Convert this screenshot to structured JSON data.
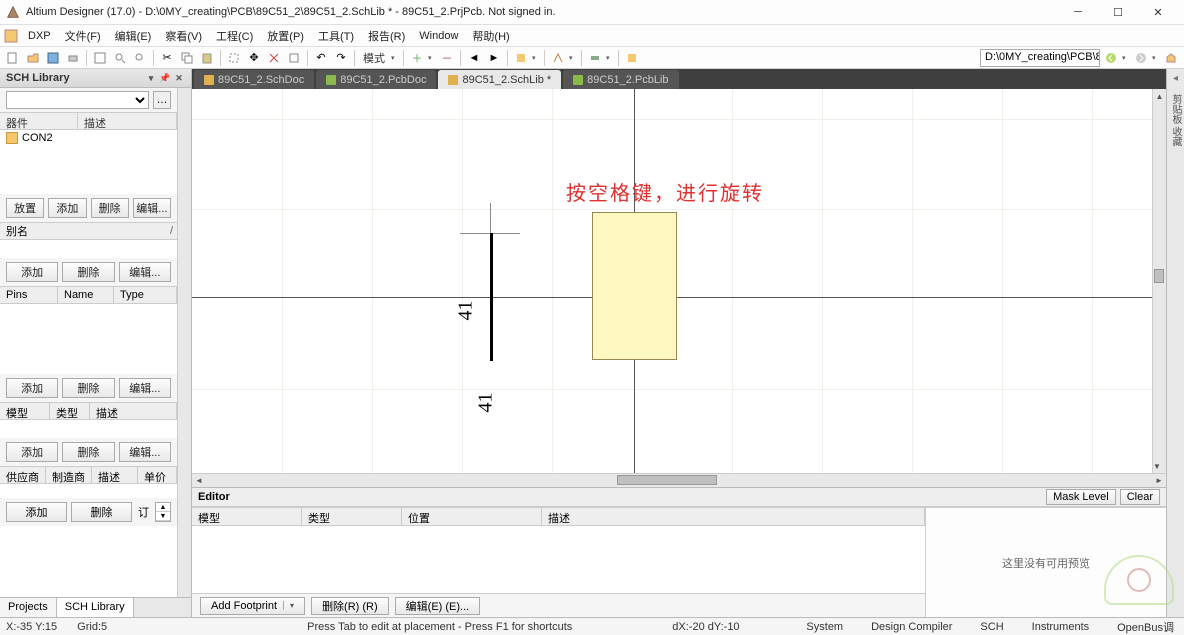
{
  "title": "Altium Designer (17.0) - D:\\0MY_creating\\PCB\\89C51_2\\89C51_2.SchLib * - 89C51_2.PrjPcb. Not signed in.",
  "menu": {
    "dxp": "DXP",
    "file": "文件(F)",
    "edit": "编辑(E)",
    "view": "察看(V)",
    "project": "工程(C)",
    "place": "放置(P)",
    "tools": "工具(T)",
    "report": "报告(R)",
    "window": "Window",
    "help": "帮助(H)"
  },
  "toolbar": {
    "mode": "模式",
    "path": "D:\\0MY_creating\\PCB\\89"
  },
  "panel": {
    "title": "SCH Library",
    "components": {
      "hdr_name": "器件",
      "hdr_desc": "描述",
      "items": [
        {
          "name": "CON2"
        }
      ]
    },
    "btns1": {
      "place": "放置",
      "add": "添加",
      "delete": "删除",
      "edit": "编辑..."
    },
    "alias": {
      "title": "别名",
      "add": "添加",
      "delete": "删除",
      "edit": "编辑..."
    },
    "pins": {
      "col1": "Pins",
      "col2": "Name",
      "col3": "Type",
      "add": "添加",
      "delete": "删除",
      "edit": "编辑..."
    },
    "model": {
      "col1": "模型",
      "col2": "类型",
      "col3": "描述",
      "add": "添加",
      "delete": "删除",
      "edit": "编辑..."
    },
    "supplier": {
      "col1": "供应商",
      "col2": "制造商",
      "col3": "描述",
      "col4": "单价",
      "add": "添加",
      "delete": "删除",
      "order": "订"
    },
    "tabs": {
      "projects": "Projects",
      "schlib": "SCH Library"
    }
  },
  "doctabs": {
    "t1": "89C51_2.SchDoc",
    "t2": "89C51_2.PcbDoc",
    "t3": "89C51_2.SchLib *",
    "t4": "89C51_2.PcbLib"
  },
  "canvas": {
    "annotation": "按空格键，进行旋转",
    "pin_label_1": "41",
    "pin_label_2": "41"
  },
  "editor": {
    "title": "Editor",
    "mask": "Mask Level",
    "clear": "Clear",
    "cols": {
      "model": "模型",
      "type": "类型",
      "pos": "位置",
      "desc": "描述"
    },
    "addfp": "Add Footprint",
    "del": "删除(R) (R)",
    "edit": "编辑(E) (E)...",
    "preview": "这里没有可用预览"
  },
  "status": {
    "coord": "X:-35 Y:15",
    "grid": "Grid:5",
    "hint": "Press Tab to edit at placement - Press F1 for shortcuts",
    "delta": "dX:-20 dY:-10",
    "links": {
      "system": "System",
      "dc": "Design Compiler",
      "sch": "SCH",
      "inst": "Instruments",
      "ob": "OpenBus调"
    }
  },
  "rightrail": {
    "tab": "剪贴板 收藏"
  }
}
